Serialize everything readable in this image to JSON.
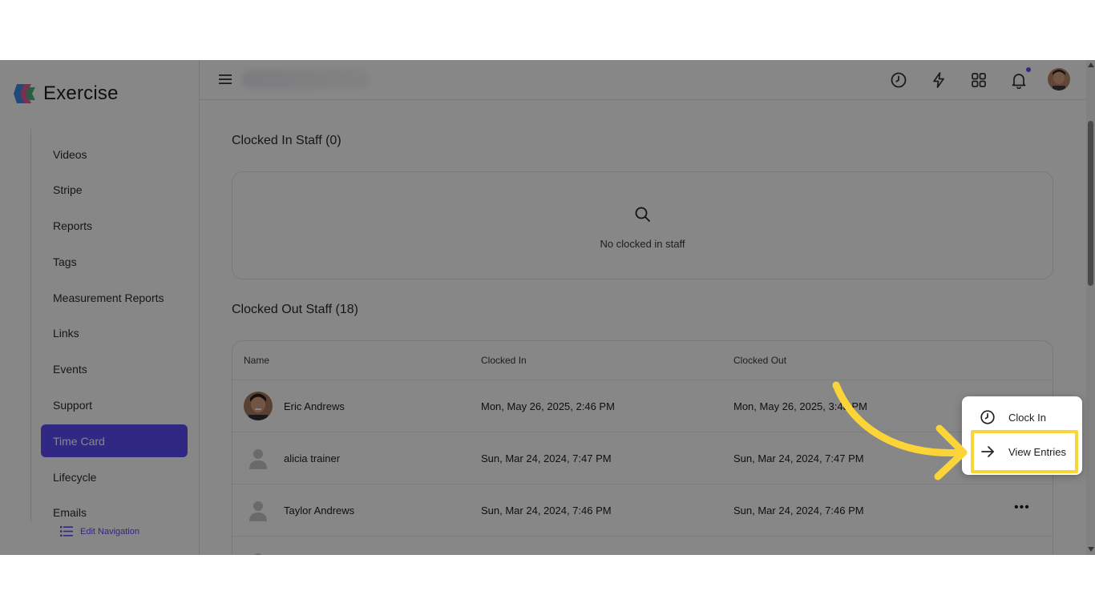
{
  "app": {
    "name": "Exercise"
  },
  "sidebar": {
    "items": [
      {
        "label": "Videos"
      },
      {
        "label": "Stripe"
      },
      {
        "label": "Reports"
      },
      {
        "label": "Tags"
      },
      {
        "label": "Measurement Reports"
      },
      {
        "label": "Links"
      },
      {
        "label": "Events"
      },
      {
        "label": "Support"
      },
      {
        "label": "Time Card",
        "active": true
      },
      {
        "label": "Lifecycle"
      },
      {
        "label": "Emails"
      }
    ],
    "edit_navigation": "Edit Navigation"
  },
  "header": {
    "icons": [
      "menu-icon",
      "clock-icon",
      "lightning-icon",
      "apps-grid-icon",
      "bell-icon"
    ],
    "notification_dot_color": "#5b4cf5"
  },
  "clocked_in": {
    "title": "Clocked In Staff (0)",
    "empty_message": "No clocked in staff"
  },
  "clocked_out": {
    "title": "Clocked Out Staff (18)",
    "columns": [
      "Name",
      "Clocked In",
      "Clocked Out"
    ],
    "rows": [
      {
        "name": "Eric Andrews",
        "clocked_in": "Mon, May 26, 2025, 2:46 PM",
        "clocked_out": "Mon, May 26, 2025, 3:48 PM",
        "avatar": "photo"
      },
      {
        "name": "alicia trainer",
        "clocked_in": "Sun, Mar 24, 2024, 7:47 PM",
        "clocked_out": "Sun, Mar 24, 2024, 7:47 PM",
        "avatar": "placeholder"
      },
      {
        "name": "Taylor Andrews",
        "clocked_in": "Sun, Mar 24, 2024, 7:46 PM",
        "clocked_out": "Sun, Mar 24, 2024, 7:46 PM",
        "avatar": "placeholder"
      }
    ],
    "more_label": "•••"
  },
  "dropdown": {
    "items": [
      {
        "label": "Clock In",
        "icon": "clock-icon"
      },
      {
        "label": "View Entries",
        "icon": "arrow-right-icon"
      }
    ]
  },
  "colors": {
    "accent": "#5b4cf5",
    "highlight": "#fbd437"
  }
}
